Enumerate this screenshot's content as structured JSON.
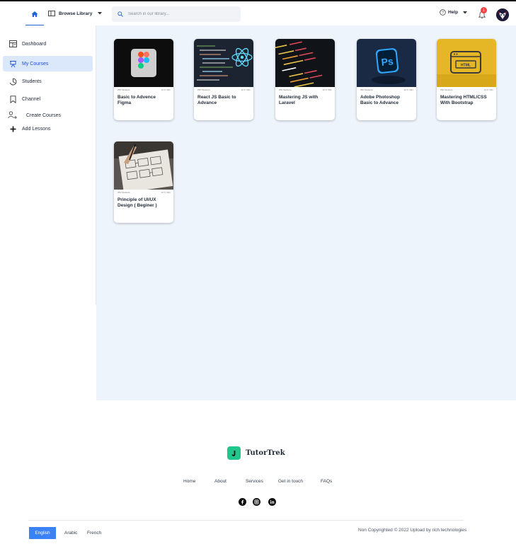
{
  "header": {
    "browse_label": "Browse Library",
    "search_placeholder": "Search in our library...",
    "help_label": "Help",
    "notification_count": "1"
  },
  "sidebar": {
    "items": [
      {
        "label": "Dashboard",
        "icon": "dashboard-icon"
      },
      {
        "label": "My Courses",
        "icon": "courses-icon",
        "active": true
      },
      {
        "label": "Students",
        "icon": "students-icon"
      },
      {
        "label": "Channel",
        "icon": "bookmark-icon"
      },
      {
        "label": "Create Courses",
        "icon": "add-user-icon"
      },
      {
        "label": "Add Lessons",
        "icon": "plus-icon"
      }
    ]
  },
  "courses": [
    {
      "title": "Basic to Advence Figma",
      "students": "250 Students",
      "duration": "12 hr 30m",
      "thumb": "figma"
    },
    {
      "title": "React JS Basic to Advance",
      "students": "250 Students",
      "duration": "12 hr 30m",
      "thumb": "react"
    },
    {
      "title": "Mastering JS with Laravel",
      "students": "250 Students",
      "duration": "12 hr 30m",
      "thumb": "code"
    },
    {
      "title": "Adobe Photoshop Basic to Advance",
      "students": "250 Students",
      "duration": "12 hr 30m",
      "thumb": "photoshop"
    },
    {
      "title": "Mastering HTML/CSS With Bootstrap",
      "students": "250 Students",
      "duration": "12 hr 30m",
      "thumb": "html"
    },
    {
      "title": "Principle of UI/UX Design ( Beginer )",
      "students": "250 Students",
      "duration": "12 hr 30m",
      "thumb": "sketch"
    }
  ],
  "footer": {
    "brand": "TutorTrek",
    "nav": [
      "Home",
      "About",
      "Services",
      "Get in touch",
      "FAQs"
    ],
    "social": [
      "facebook-icon",
      "instagram-icon",
      "linkedin-icon"
    ],
    "languages": [
      "English",
      "Arabic",
      "French"
    ],
    "copyright": "Non Copyrighted © 2022 Upload by rich technologies"
  },
  "colors": {
    "accent": "#1d63d8",
    "brand": "#22c58b",
    "active_bg": "#dbe8fb",
    "main_bg": "#eef4fb",
    "badge": "#ef4444"
  }
}
